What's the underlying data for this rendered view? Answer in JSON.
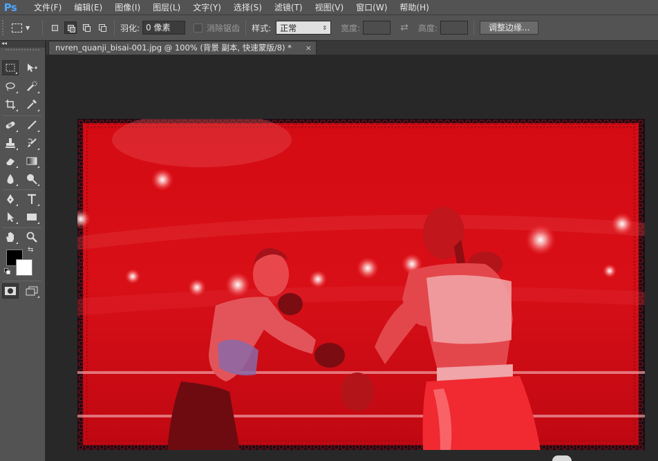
{
  "app": {
    "logo": "Ps"
  },
  "menu": [
    "文件(F)",
    "编辑(E)",
    "图像(I)",
    "图层(L)",
    "文字(Y)",
    "选择(S)",
    "滤镜(T)",
    "视图(V)",
    "窗口(W)",
    "帮助(H)"
  ],
  "options": {
    "feather_label": "羽化:",
    "feather_value": "0 像素",
    "antialias_label": "消除锯齿",
    "style_label": "样式:",
    "style_value": "正常",
    "width_label": "宽度:",
    "height_label": "高度:",
    "refine_edge_button": "调整边缘..."
  },
  "toolbox": {
    "collapse_label": "◂◂"
  },
  "document": {
    "tab_title": "nvren_quanji_bisai-001.jpg @ 100% (背景 副本, 快速蒙版/8) *",
    "close_label": "×"
  },
  "icons": {
    "tool_icons": [
      "rectangular-marquee",
      "move",
      "lasso",
      "quick-selection",
      "crop",
      "eyedropper",
      "spot-healing-brush",
      "brush",
      "clone-stamp",
      "history-brush",
      "eraser",
      "gradient",
      "blur",
      "dodge",
      "pen",
      "type",
      "path-selection",
      "rectangle",
      "hand",
      "zoom"
    ]
  },
  "colors": {
    "menubar_bg": "#535353",
    "workspace_bg": "#282828",
    "quick_mask_overlay": "#d90d12",
    "foreground": "#000000",
    "background": "#ffffff",
    "logo": "#4da6ff"
  }
}
